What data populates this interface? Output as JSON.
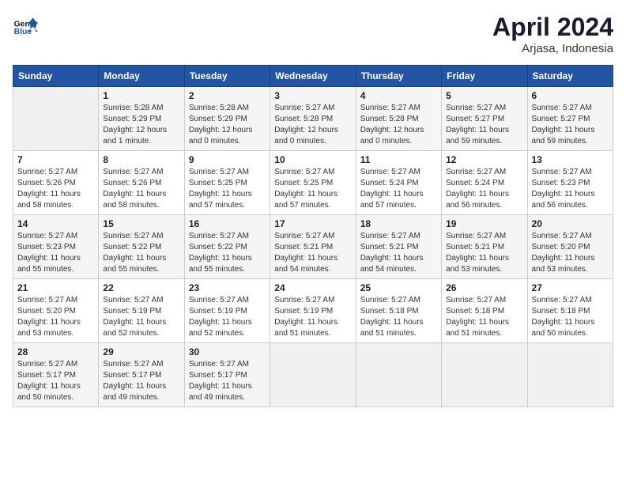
{
  "header": {
    "logo_line1": "General",
    "logo_line2": "Blue",
    "month_title": "April 2024",
    "location": "Arjasa, Indonesia"
  },
  "weekdays": [
    "Sunday",
    "Monday",
    "Tuesday",
    "Wednesday",
    "Thursday",
    "Friday",
    "Saturday"
  ],
  "weeks": [
    [
      {
        "day": null
      },
      {
        "day": "1",
        "sunrise": "5:28 AM",
        "sunset": "5:29 PM",
        "daylight": "12 hours and 1 minute."
      },
      {
        "day": "2",
        "sunrise": "5:28 AM",
        "sunset": "5:29 PM",
        "daylight": "12 hours and 0 minutes."
      },
      {
        "day": "3",
        "sunrise": "5:27 AM",
        "sunset": "5:28 PM",
        "daylight": "12 hours and 0 minutes."
      },
      {
        "day": "4",
        "sunrise": "5:27 AM",
        "sunset": "5:28 PM",
        "daylight": "12 hours and 0 minutes."
      },
      {
        "day": "5",
        "sunrise": "5:27 AM",
        "sunset": "5:27 PM",
        "daylight": "11 hours and 59 minutes."
      },
      {
        "day": "6",
        "sunrise": "5:27 AM",
        "sunset": "5:27 PM",
        "daylight": "11 hours and 59 minutes."
      }
    ],
    [
      {
        "day": "7",
        "sunrise": "5:27 AM",
        "sunset": "5:26 PM",
        "daylight": "11 hours and 58 minutes."
      },
      {
        "day": "8",
        "sunrise": "5:27 AM",
        "sunset": "5:26 PM",
        "daylight": "11 hours and 58 minutes."
      },
      {
        "day": "9",
        "sunrise": "5:27 AM",
        "sunset": "5:25 PM",
        "daylight": "11 hours and 57 minutes."
      },
      {
        "day": "10",
        "sunrise": "5:27 AM",
        "sunset": "5:25 PM",
        "daylight": "11 hours and 57 minutes."
      },
      {
        "day": "11",
        "sunrise": "5:27 AM",
        "sunset": "5:24 PM",
        "daylight": "11 hours and 57 minutes."
      },
      {
        "day": "12",
        "sunrise": "5:27 AM",
        "sunset": "5:24 PM",
        "daylight": "11 hours and 56 minutes."
      },
      {
        "day": "13",
        "sunrise": "5:27 AM",
        "sunset": "5:23 PM",
        "daylight": "11 hours and 56 minutes."
      }
    ],
    [
      {
        "day": "14",
        "sunrise": "5:27 AM",
        "sunset": "5:23 PM",
        "daylight": "11 hours and 55 minutes."
      },
      {
        "day": "15",
        "sunrise": "5:27 AM",
        "sunset": "5:22 PM",
        "daylight": "11 hours and 55 minutes."
      },
      {
        "day": "16",
        "sunrise": "5:27 AM",
        "sunset": "5:22 PM",
        "daylight": "11 hours and 55 minutes."
      },
      {
        "day": "17",
        "sunrise": "5:27 AM",
        "sunset": "5:21 PM",
        "daylight": "11 hours and 54 minutes."
      },
      {
        "day": "18",
        "sunrise": "5:27 AM",
        "sunset": "5:21 PM",
        "daylight": "11 hours and 54 minutes."
      },
      {
        "day": "19",
        "sunrise": "5:27 AM",
        "sunset": "5:21 PM",
        "daylight": "11 hours and 53 minutes."
      },
      {
        "day": "20",
        "sunrise": "5:27 AM",
        "sunset": "5:20 PM",
        "daylight": "11 hours and 53 minutes."
      }
    ],
    [
      {
        "day": "21",
        "sunrise": "5:27 AM",
        "sunset": "5:20 PM",
        "daylight": "11 hours and 53 minutes."
      },
      {
        "day": "22",
        "sunrise": "5:27 AM",
        "sunset": "5:19 PM",
        "daylight": "11 hours and 52 minutes."
      },
      {
        "day": "23",
        "sunrise": "5:27 AM",
        "sunset": "5:19 PM",
        "daylight": "11 hours and 52 minutes."
      },
      {
        "day": "24",
        "sunrise": "5:27 AM",
        "sunset": "5:19 PM",
        "daylight": "11 hours and 51 minutes."
      },
      {
        "day": "25",
        "sunrise": "5:27 AM",
        "sunset": "5:18 PM",
        "daylight": "11 hours and 51 minutes."
      },
      {
        "day": "26",
        "sunrise": "5:27 AM",
        "sunset": "5:18 PM",
        "daylight": "11 hours and 51 minutes."
      },
      {
        "day": "27",
        "sunrise": "5:27 AM",
        "sunset": "5:18 PM",
        "daylight": "11 hours and 50 minutes."
      }
    ],
    [
      {
        "day": "28",
        "sunrise": "5:27 AM",
        "sunset": "5:17 PM",
        "daylight": "11 hours and 50 minutes."
      },
      {
        "day": "29",
        "sunrise": "5:27 AM",
        "sunset": "5:17 PM",
        "daylight": "11 hours and 49 minutes."
      },
      {
        "day": "30",
        "sunrise": "5:27 AM",
        "sunset": "5:17 PM",
        "daylight": "11 hours and 49 minutes."
      },
      {
        "day": null
      },
      {
        "day": null
      },
      {
        "day": null
      },
      {
        "day": null
      }
    ]
  ]
}
